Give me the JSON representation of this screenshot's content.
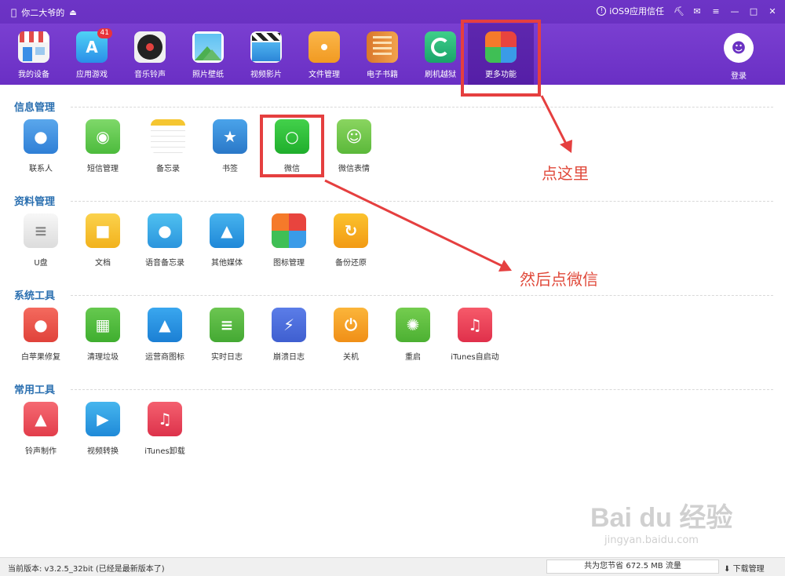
{
  "titlebar": {
    "device_name": "你二大爷的",
    "ios_trust": "iOS9应用信任"
  },
  "toolbar": {
    "items": [
      {
        "label": "我的设备"
      },
      {
        "label": "应用游戏",
        "badge": "41"
      },
      {
        "label": "音乐铃声"
      },
      {
        "label": "照片壁纸"
      },
      {
        "label": "视频影片"
      },
      {
        "label": "文件管理"
      },
      {
        "label": "电子书籍"
      },
      {
        "label": "刷机越狱"
      },
      {
        "label": "更多功能"
      }
    ],
    "login_label": "登录"
  },
  "sections": {
    "info": {
      "title": "信息管理",
      "apps": [
        "联系人",
        "短信管理",
        "备忘录",
        "书签",
        "微信",
        "微信表情"
      ]
    },
    "data": {
      "title": "资料管理",
      "apps": [
        "U盘",
        "文档",
        "语音备忘录",
        "其他媒体",
        "图标管理",
        "备份还原"
      ]
    },
    "system": {
      "title": "系统工具",
      "apps": [
        "白苹果修复",
        "清理垃圾",
        "运营商图标",
        "实时日志",
        "崩溃日志",
        "关机",
        "重启",
        "iTunes自启动"
      ]
    },
    "common": {
      "title": "常用工具",
      "apps": [
        "铃声制作",
        "视频转换",
        "iTunes卸载"
      ]
    }
  },
  "annotations": {
    "click_here": "点这里",
    "then_wechat": "然后点微信"
  },
  "statusbar": {
    "version": "当前版本: v3.2.5_32bit  (已经是最新版本了)",
    "saved": "共为您节省  672.5 MB 流量",
    "download": "下载管理"
  },
  "watermark": {
    "brand": "Bai du 经验",
    "url": "jingyan.baidu.com"
  }
}
